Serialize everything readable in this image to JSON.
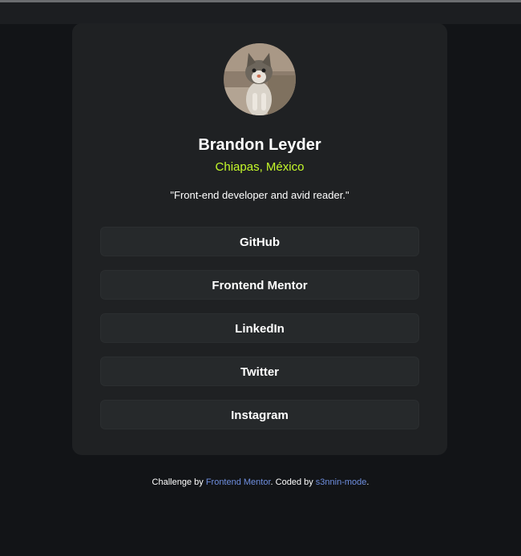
{
  "profile": {
    "name": "Brandon Leyder",
    "location": "Chiapas, México",
    "bio": "\"Front-end developer and avid reader.\"",
    "avatar_alt": "cat-photo"
  },
  "links": [
    {
      "label": "GitHub"
    },
    {
      "label": "Frontend Mentor"
    },
    {
      "label": "LinkedIn"
    },
    {
      "label": "Twitter"
    },
    {
      "label": "Instagram"
    }
  ],
  "footer": {
    "prefix": "Challenge by ",
    "challenge_link": "Frontend Mentor",
    "middle": ". Coded by ",
    "author_link": "s3nnin-mode",
    "suffix": "."
  },
  "colors": {
    "background": "#121417",
    "card": "#1f2123",
    "button": "#26292b",
    "accent": "#c4f82a",
    "link": "#6f8fe0"
  }
}
